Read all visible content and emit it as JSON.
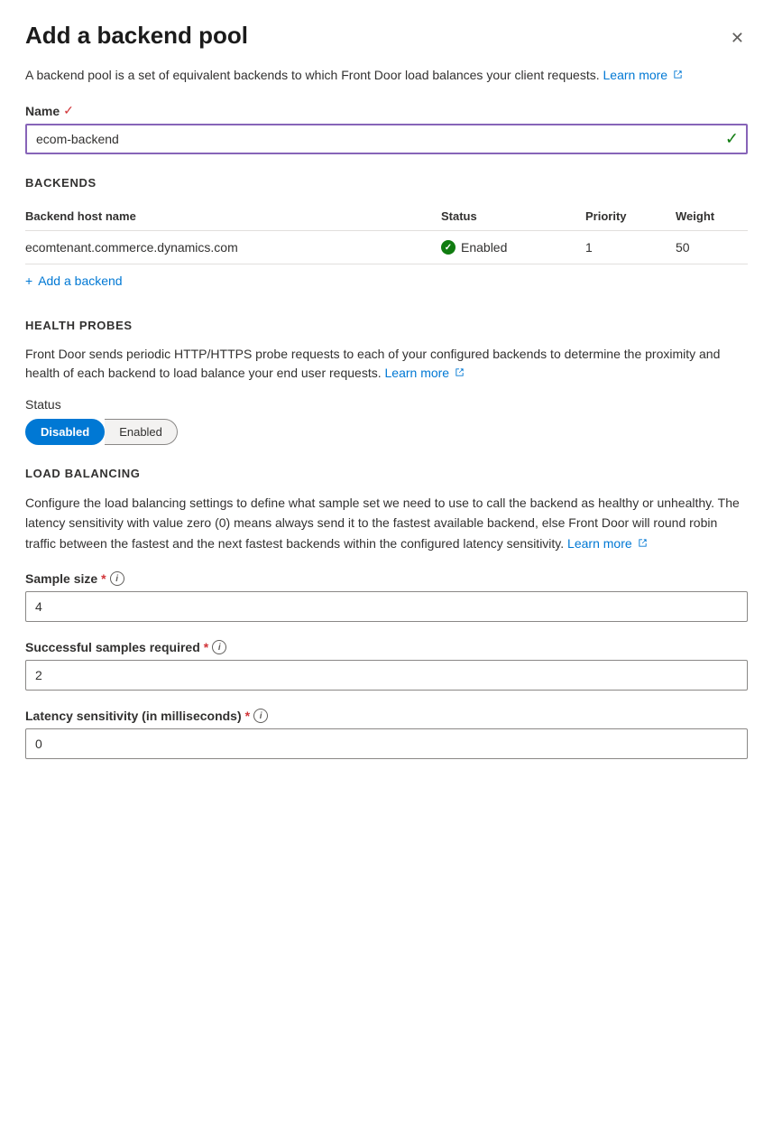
{
  "panel": {
    "title": "Add a backend pool",
    "close_label": "×"
  },
  "description": {
    "text": "A backend pool is a set of equivalent backends to which Front Door load balances your client requests.",
    "learn_more_label": "Learn more",
    "learn_more_url": "#"
  },
  "name_field": {
    "label": "Name",
    "required": true,
    "value": "ecom-backend",
    "placeholder": ""
  },
  "backends": {
    "section_title": "BACKENDS",
    "columns": {
      "host_name": "Backend host name",
      "status": "Status",
      "priority": "Priority",
      "weight": "Weight"
    },
    "rows": [
      {
        "host_name": "ecomtenant.commerce.dynamics.com",
        "status": "Enabled",
        "priority": "1",
        "weight": "50"
      }
    ],
    "add_label": "Add a backend"
  },
  "health_probes": {
    "section_title": "HEALTH PROBES",
    "description": "Front Door sends periodic HTTP/HTTPS probe requests to each of your configured backends to determine the proximity and health of each backend to load balance your end user requests.",
    "learn_more_label": "Learn more",
    "learn_more_url": "#",
    "status_label": "Status",
    "toggle_options": [
      {
        "label": "Disabled",
        "active": true
      },
      {
        "label": "Enabled",
        "active": false
      }
    ]
  },
  "load_balancing": {
    "section_title": "LOAD BALANCING",
    "description": "Configure the load balancing settings to define what sample set we need to use to call the backend as healthy or unhealthy. The latency sensitivity with value zero (0) means always send it to the fastest available backend, else Front Door will round robin traffic between the fastest and the next fastest backends within the configured latency sensitivity.",
    "learn_more_label": "Learn more",
    "learn_more_url": "#",
    "sample_size": {
      "label": "Sample size",
      "required": true,
      "value": "4",
      "placeholder": ""
    },
    "successful_samples": {
      "label": "Successful samples required",
      "required": true,
      "value": "2",
      "placeholder": ""
    },
    "latency_sensitivity": {
      "label": "Latency sensitivity (in milliseconds)",
      "required": true,
      "value": "0",
      "placeholder": ""
    }
  },
  "icons": {
    "close": "✕",
    "check": "✓",
    "plus": "+",
    "external_link": "↗",
    "info": "i",
    "valid_check": "✓"
  }
}
